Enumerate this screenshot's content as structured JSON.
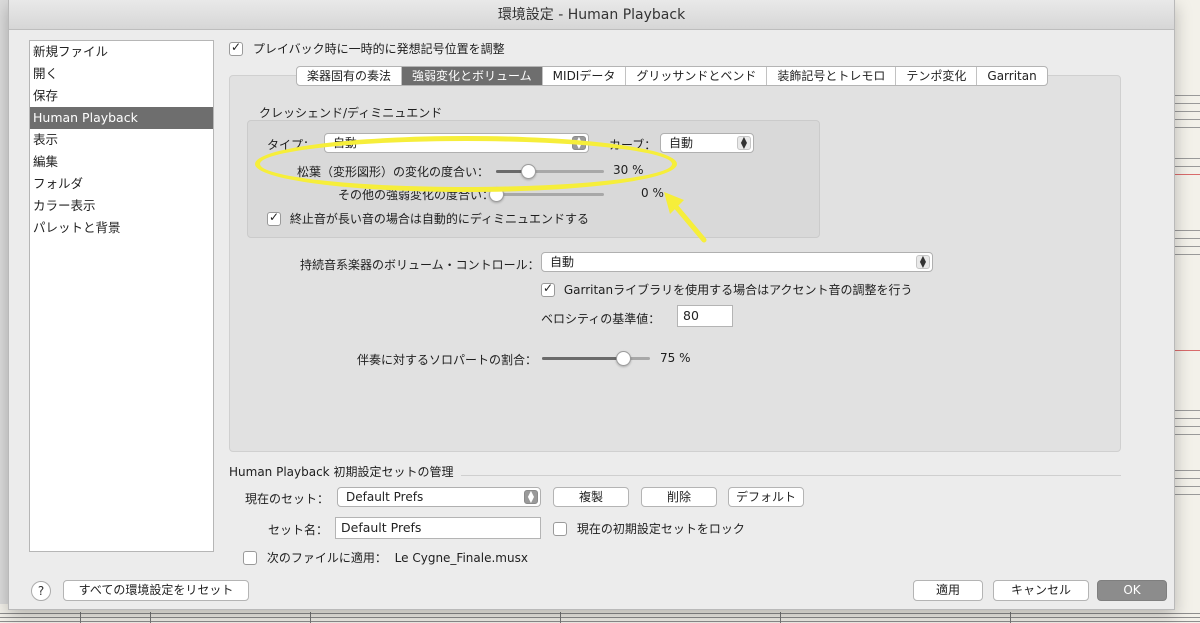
{
  "window": {
    "title": "環境設定 - Human Playback"
  },
  "sidebar": {
    "items": [
      {
        "label": "新規ファイル"
      },
      {
        "label": "開く"
      },
      {
        "label": "保存"
      },
      {
        "label": "Human Playback",
        "selected": true
      },
      {
        "label": "表示"
      },
      {
        "label": "編集"
      },
      {
        "label": "フォルダ"
      },
      {
        "label": "カラー表示"
      },
      {
        "label": "パレットと背景"
      }
    ]
  },
  "top_checkbox": {
    "label": "プレイバック時に一時的に発想記号位置を調整",
    "checked": true
  },
  "tabs": [
    {
      "label": "楽器固有の奏法"
    },
    {
      "label": "強弱変化とボリューム",
      "active": true
    },
    {
      "label": "MIDIデータ"
    },
    {
      "label": "グリッサンドとベンド"
    },
    {
      "label": "装飾記号とトレモロ"
    },
    {
      "label": "テンポ変化"
    },
    {
      "label": "Garritan"
    }
  ],
  "cresc": {
    "section_title": "クレッシェンド/ディミニュエンド",
    "type_label": "タイプ：",
    "type_value": "自動",
    "curve_label": "カーブ：",
    "curve_value": "自動",
    "hairpin_label": "松葉（変形図形）の変化の度合い：",
    "hairpin_value": "30 %",
    "hairpin_fraction": 0.3,
    "other_label": "その他の強弱変化の度合い：",
    "other_value": "0 %",
    "other_fraction": 0.0,
    "auto_dim_label": "終止音が長い音の場合は自動的にディミニュエンドする",
    "auto_dim_checked": true
  },
  "sustain": {
    "label": "持続音系楽器のボリューム・コントロール：",
    "value": "自動",
    "garritan_label": "Garritanライブラリを使用する場合はアクセント音の調整を行う",
    "garritan_checked": true,
    "velocity_label": "ベロシティの基準値：",
    "velocity_value": "80"
  },
  "solo": {
    "label": "伴奏に対するソロパートの割合：",
    "value": "75 %",
    "fraction": 0.75
  },
  "prefs": {
    "section_title": "Human Playback 初期設定セットの管理",
    "current_label": "現在のセット：",
    "current_value": "Default Prefs",
    "duplicate_button": "複製",
    "delete_button": "削除",
    "default_button": "デフォルト",
    "name_label": "セット名：",
    "name_value": "Default Prefs",
    "lock_label": "現在の初期設定セットをロック",
    "lock_checked": false,
    "apply_next_label": "次のファイルに適用：",
    "apply_next_file": "Le Cygne_Finale.musx",
    "apply_next_checked": false
  },
  "footer": {
    "help": "?",
    "reset_button": "すべての環境設定をリセット",
    "apply_button": "適用",
    "cancel_button": "キャンセル",
    "ok_button": "OK"
  },
  "colors": {
    "annotation": "#f6ee3a",
    "selection": "#6e6e6e"
  }
}
